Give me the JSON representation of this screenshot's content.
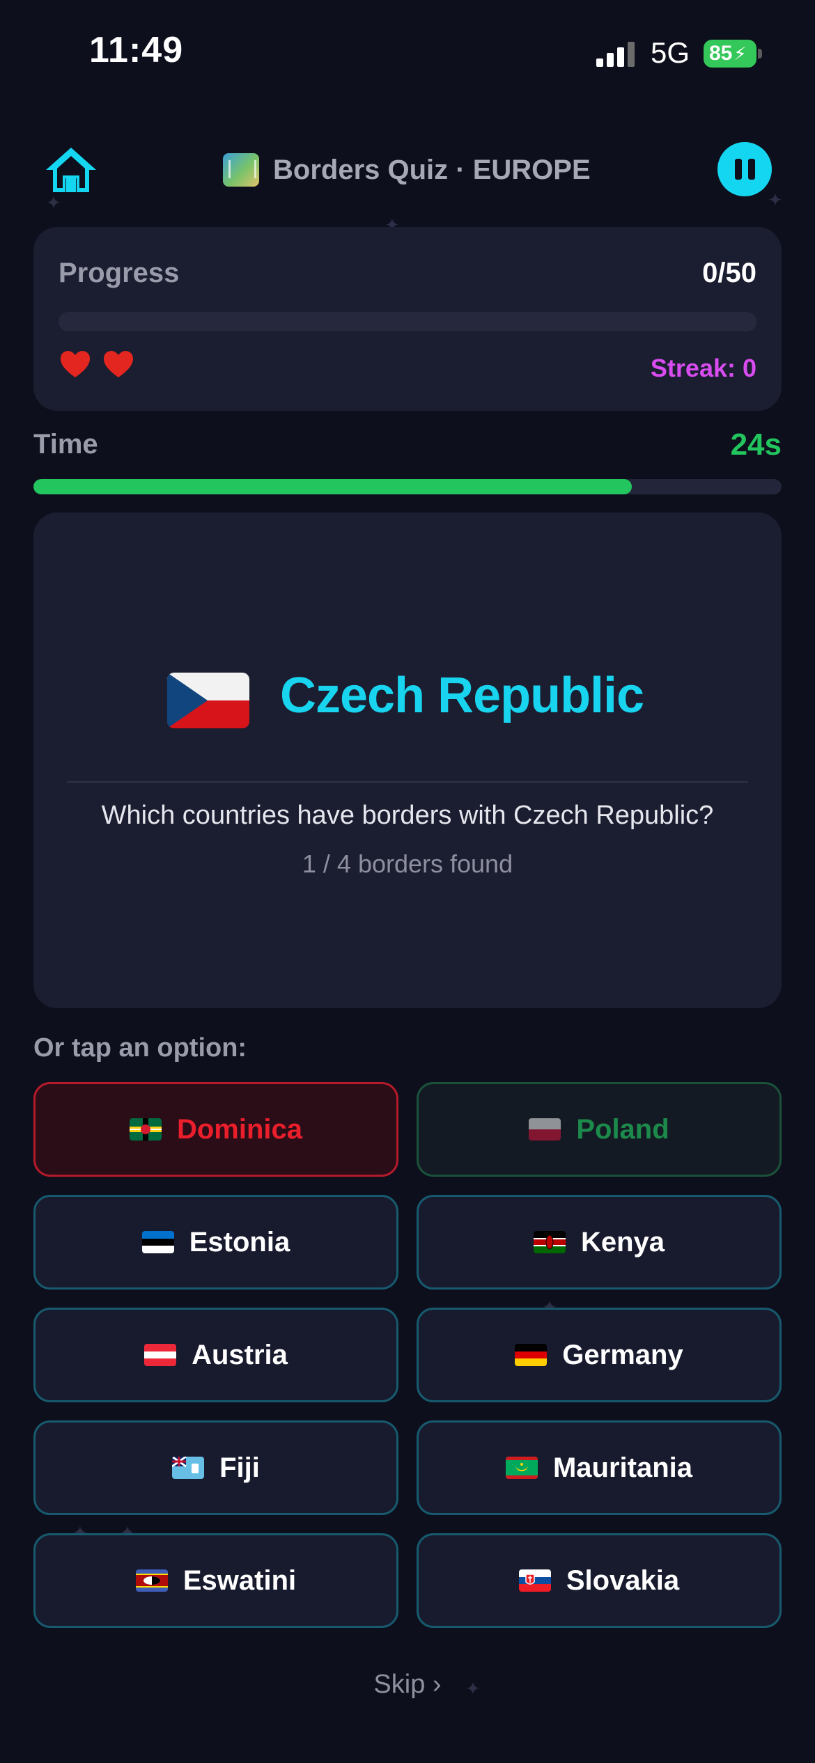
{
  "status_bar": {
    "time": "11:49",
    "network": "5G",
    "battery": "85"
  },
  "header": {
    "title": "Borders Quiz · EUROPE",
    "home_icon": "home-icon",
    "pause_icon": "pause-icon"
  },
  "progress": {
    "label": "Progress",
    "count": "0/50",
    "fraction": 0,
    "lives": 2,
    "streak": "Streak: 0"
  },
  "timer": {
    "label": "Time",
    "value": "24s",
    "fraction": 0.8
  },
  "question": {
    "country": "Czech Republic",
    "text": "Which countries have borders with Czech Republic?",
    "found": "1 / 4 borders found"
  },
  "options": {
    "label": "Or tap an option:",
    "items": [
      {
        "label": "Dominica",
        "state": "wrong"
      },
      {
        "label": "Poland",
        "state": "correct"
      },
      {
        "label": "Estonia",
        "state": "default"
      },
      {
        "label": "Kenya",
        "state": "default"
      },
      {
        "label": "Austria",
        "state": "default"
      },
      {
        "label": "Germany",
        "state": "default"
      },
      {
        "label": "Fiji",
        "state": "default"
      },
      {
        "label": "Mauritania",
        "state": "default"
      },
      {
        "label": "Eswatini",
        "state": "default"
      },
      {
        "label": "Slovakia",
        "state": "default"
      }
    ]
  },
  "skip_label": "Skip ›",
  "colors": {
    "accent": "#18d4ef",
    "timer": "#22c55e",
    "streak": "#d84cf0",
    "wrong": "#ea1f2b",
    "correct": "#1c8a4a"
  }
}
